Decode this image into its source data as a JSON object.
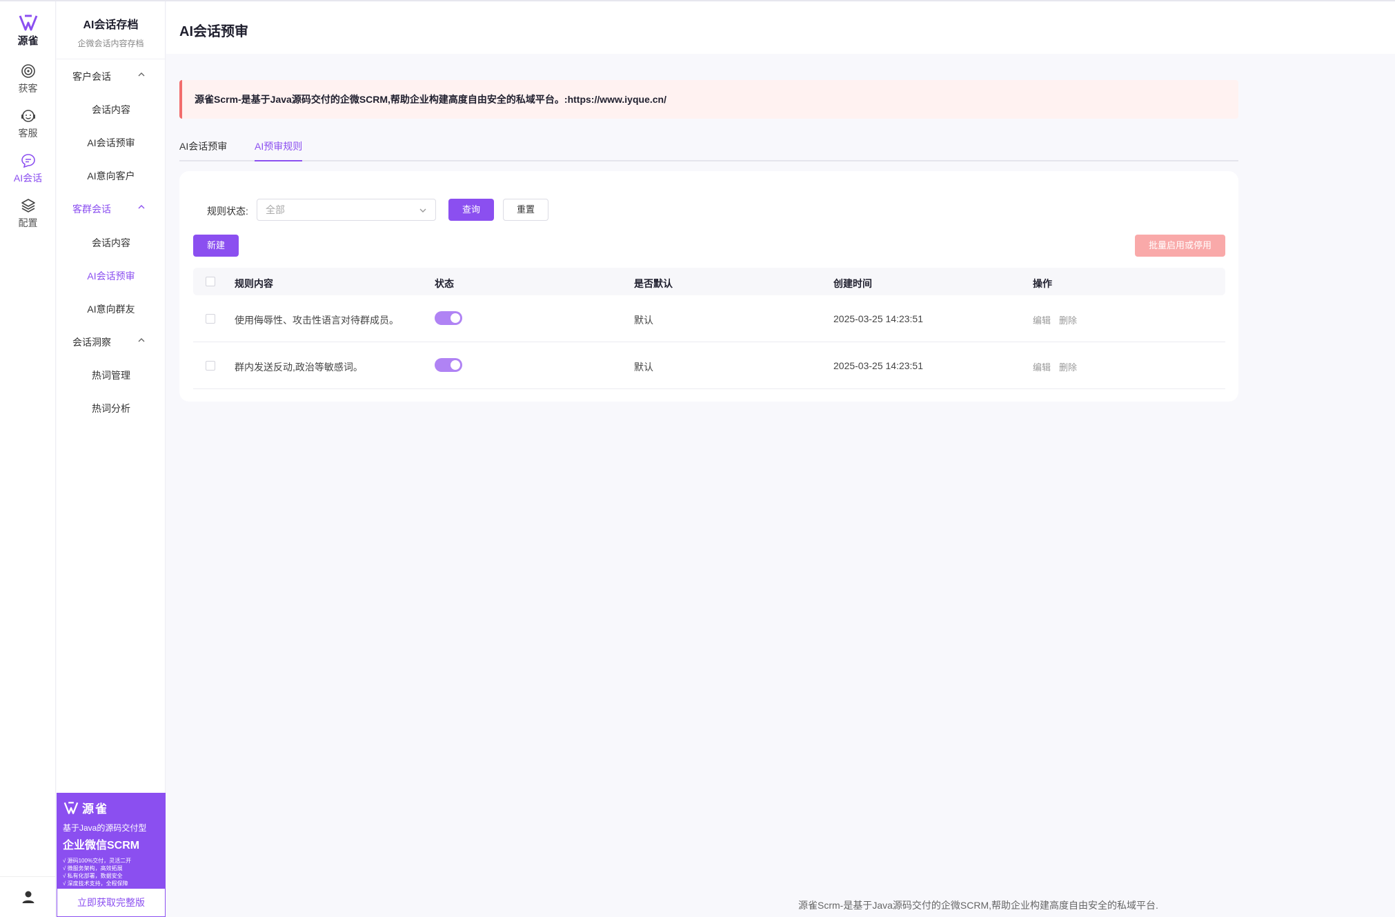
{
  "rail": {
    "brand": "源雀",
    "items": [
      {
        "label": "获客",
        "icon": "target-icon"
      },
      {
        "label": "客服",
        "icon": "headset-icon"
      },
      {
        "label": "AI会话",
        "icon": "chat-bubble-icon"
      },
      {
        "label": "配置",
        "icon": "layers-icon"
      }
    ]
  },
  "menu": {
    "title": "AI会话存档",
    "subtitle": "企微会话内容存档",
    "groups": [
      {
        "label": "客户会话",
        "items": [
          "会话内容",
          "AI会话预审",
          "AI意向客户"
        ]
      },
      {
        "label": "客群会话",
        "items": [
          "会话内容",
          "AI会话预审",
          "AI意向群友"
        ]
      },
      {
        "label": "会话洞察",
        "items": [
          "热词管理",
          "热词分析"
        ]
      }
    ],
    "promo": {
      "brand": "源雀",
      "line1": "基于Java的源码交付型",
      "line2": "企业微信SCRM",
      "bullets": [
        "√ 源码100%交付，灵活二开",
        "√ 微服务架构，高效拓展",
        "√ 私有化部署，数据安全",
        "√ 深度技术支持，全程保障"
      ],
      "cta": "立即获取完整版"
    }
  },
  "main": {
    "title": "AI会话预审",
    "notice": "源雀Scrm-是基于Java源码交付的企微SCRM,帮助企业构建高度自由安全的私域平台。:https://www.iyque.cn/",
    "tabs": [
      "AI会话预审",
      "AI预审规则"
    ],
    "filter": {
      "label": "规则状态:",
      "placeholder": "全部",
      "query": "查询",
      "reset": "重置"
    },
    "new_button": "新建",
    "batch_button": "批量启用或停用",
    "table": {
      "columns": [
        "规则内容",
        "状态",
        "是否默认",
        "创建时间",
        "操作"
      ],
      "rows": [
        {
          "content": "使用侮辱性、攻击性语言对待群成员。",
          "enabled": true,
          "default": "默认",
          "created": "2025-03-25 14:23:51",
          "edit": "编辑",
          "delete": "删除"
        },
        {
          "content": "群内发送反动,政治等敏感词。",
          "enabled": true,
          "default": "默认",
          "created": "2025-03-25 14:23:51",
          "edit": "编辑",
          "delete": "删除"
        }
      ]
    }
  },
  "footer": "源雀Scrm-是基于Java源码交付的企微SCRM,帮助企业构建高度自由安全的私域平台.",
  "colors": {
    "accent": "#8b4ff0",
    "notice_border": "#f26c6c",
    "toggle_on": "#b083f4"
  }
}
